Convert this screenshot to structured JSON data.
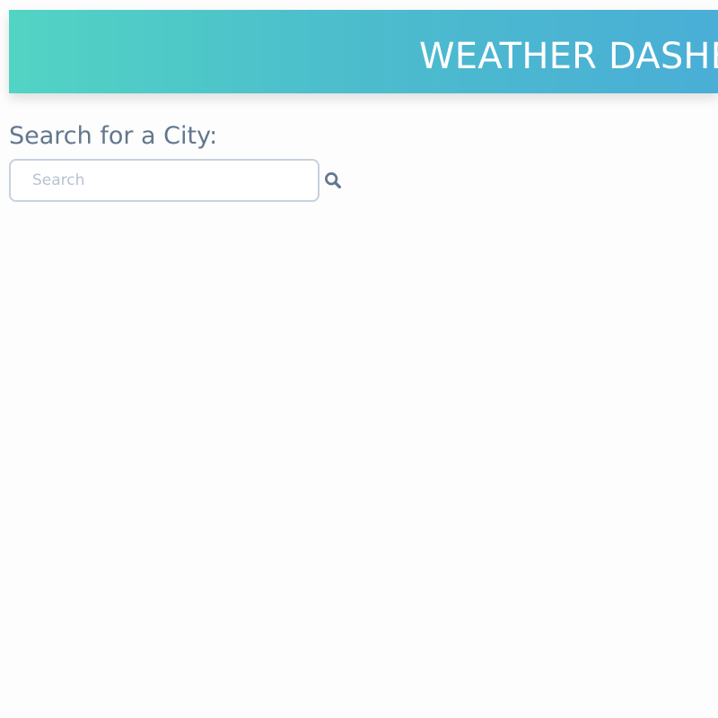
{
  "header": {
    "title": "WEATHER DASHBOARD",
    "gradient_start": "#52d4c4",
    "gradient_end": "#4aaed6"
  },
  "search": {
    "label": "Search for a City:",
    "placeholder": "Search",
    "value": "",
    "button_icon": "search-icon"
  },
  "colors": {
    "text": "#62778e",
    "input_border": "#c7d1df",
    "background": "#fdfdfd"
  }
}
